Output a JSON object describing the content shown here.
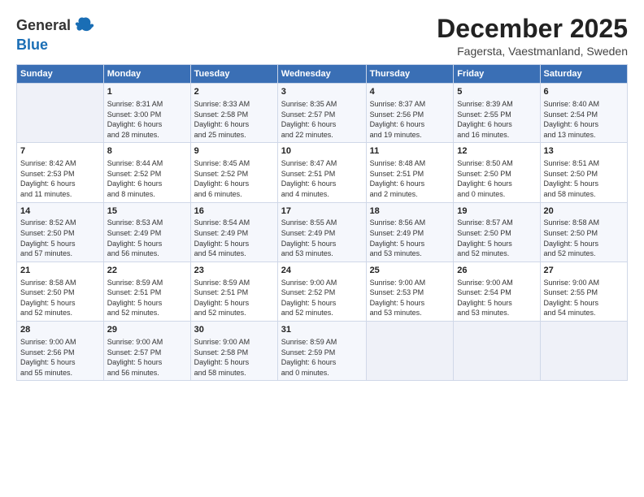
{
  "header": {
    "logo": {
      "line1": "General",
      "line2": "Blue"
    },
    "title": "December 2025",
    "subtitle": "Fagersta, Vaestmanland, Sweden"
  },
  "weekdays": [
    "Sunday",
    "Monday",
    "Tuesday",
    "Wednesday",
    "Thursday",
    "Friday",
    "Saturday"
  ],
  "weeks": [
    [
      {
        "day": "",
        "info": ""
      },
      {
        "day": "1",
        "info": "Sunrise: 8:31 AM\nSunset: 3:00 PM\nDaylight: 6 hours\nand 28 minutes."
      },
      {
        "day": "2",
        "info": "Sunrise: 8:33 AM\nSunset: 2:58 PM\nDaylight: 6 hours\nand 25 minutes."
      },
      {
        "day": "3",
        "info": "Sunrise: 8:35 AM\nSunset: 2:57 PM\nDaylight: 6 hours\nand 22 minutes."
      },
      {
        "day": "4",
        "info": "Sunrise: 8:37 AM\nSunset: 2:56 PM\nDaylight: 6 hours\nand 19 minutes."
      },
      {
        "day": "5",
        "info": "Sunrise: 8:39 AM\nSunset: 2:55 PM\nDaylight: 6 hours\nand 16 minutes."
      },
      {
        "day": "6",
        "info": "Sunrise: 8:40 AM\nSunset: 2:54 PM\nDaylight: 6 hours\nand 13 minutes."
      }
    ],
    [
      {
        "day": "7",
        "info": "Sunrise: 8:42 AM\nSunset: 2:53 PM\nDaylight: 6 hours\nand 11 minutes."
      },
      {
        "day": "8",
        "info": "Sunrise: 8:44 AM\nSunset: 2:52 PM\nDaylight: 6 hours\nand 8 minutes."
      },
      {
        "day": "9",
        "info": "Sunrise: 8:45 AM\nSunset: 2:52 PM\nDaylight: 6 hours\nand 6 minutes."
      },
      {
        "day": "10",
        "info": "Sunrise: 8:47 AM\nSunset: 2:51 PM\nDaylight: 6 hours\nand 4 minutes."
      },
      {
        "day": "11",
        "info": "Sunrise: 8:48 AM\nSunset: 2:51 PM\nDaylight: 6 hours\nand 2 minutes."
      },
      {
        "day": "12",
        "info": "Sunrise: 8:50 AM\nSunset: 2:50 PM\nDaylight: 6 hours\nand 0 minutes."
      },
      {
        "day": "13",
        "info": "Sunrise: 8:51 AM\nSunset: 2:50 PM\nDaylight: 5 hours\nand 58 minutes."
      }
    ],
    [
      {
        "day": "14",
        "info": "Sunrise: 8:52 AM\nSunset: 2:50 PM\nDaylight: 5 hours\nand 57 minutes."
      },
      {
        "day": "15",
        "info": "Sunrise: 8:53 AM\nSunset: 2:49 PM\nDaylight: 5 hours\nand 56 minutes."
      },
      {
        "day": "16",
        "info": "Sunrise: 8:54 AM\nSunset: 2:49 PM\nDaylight: 5 hours\nand 54 minutes."
      },
      {
        "day": "17",
        "info": "Sunrise: 8:55 AM\nSunset: 2:49 PM\nDaylight: 5 hours\nand 53 minutes."
      },
      {
        "day": "18",
        "info": "Sunrise: 8:56 AM\nSunset: 2:49 PM\nDaylight: 5 hours\nand 53 minutes."
      },
      {
        "day": "19",
        "info": "Sunrise: 8:57 AM\nSunset: 2:50 PM\nDaylight: 5 hours\nand 52 minutes."
      },
      {
        "day": "20",
        "info": "Sunrise: 8:58 AM\nSunset: 2:50 PM\nDaylight: 5 hours\nand 52 minutes."
      }
    ],
    [
      {
        "day": "21",
        "info": "Sunrise: 8:58 AM\nSunset: 2:50 PM\nDaylight: 5 hours\nand 52 minutes."
      },
      {
        "day": "22",
        "info": "Sunrise: 8:59 AM\nSunset: 2:51 PM\nDaylight: 5 hours\nand 52 minutes."
      },
      {
        "day": "23",
        "info": "Sunrise: 8:59 AM\nSunset: 2:51 PM\nDaylight: 5 hours\nand 52 minutes."
      },
      {
        "day": "24",
        "info": "Sunrise: 9:00 AM\nSunset: 2:52 PM\nDaylight: 5 hours\nand 52 minutes."
      },
      {
        "day": "25",
        "info": "Sunrise: 9:00 AM\nSunset: 2:53 PM\nDaylight: 5 hours\nand 53 minutes."
      },
      {
        "day": "26",
        "info": "Sunrise: 9:00 AM\nSunset: 2:54 PM\nDaylight: 5 hours\nand 53 minutes."
      },
      {
        "day": "27",
        "info": "Sunrise: 9:00 AM\nSunset: 2:55 PM\nDaylight: 5 hours\nand 54 minutes."
      }
    ],
    [
      {
        "day": "28",
        "info": "Sunrise: 9:00 AM\nSunset: 2:56 PM\nDaylight: 5 hours\nand 55 minutes."
      },
      {
        "day": "29",
        "info": "Sunrise: 9:00 AM\nSunset: 2:57 PM\nDaylight: 5 hours\nand 56 minutes."
      },
      {
        "day": "30",
        "info": "Sunrise: 9:00 AM\nSunset: 2:58 PM\nDaylight: 5 hours\nand 58 minutes."
      },
      {
        "day": "31",
        "info": "Sunrise: 8:59 AM\nSunset: 2:59 PM\nDaylight: 6 hours\nand 0 minutes."
      },
      {
        "day": "",
        "info": ""
      },
      {
        "day": "",
        "info": ""
      },
      {
        "day": "",
        "info": ""
      }
    ]
  ]
}
